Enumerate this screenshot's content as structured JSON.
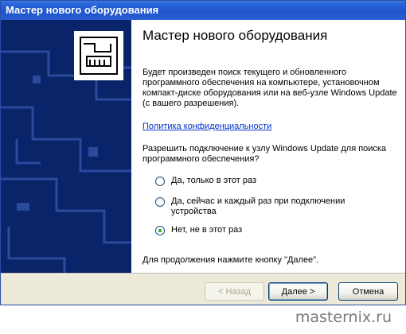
{
  "window": {
    "title": "Мастер нового оборудования"
  },
  "side": {
    "image_icon": "hardware-card-icon"
  },
  "content": {
    "heading": "Мастер нового оборудования",
    "paragraph": "Будет произведен поиск текущего и обновленного программного обеспечения на компьютере, установочном компакт-диске оборудования или на веб-узле Windows Update (с вашего разрешения).",
    "privacy_link": "Политика конфиденциальности",
    "question": "Разрешить подключение к узлу Windows Update для поиска программного обеспечения?",
    "options": [
      {
        "label": "Да, только в этот раз",
        "checked": false
      },
      {
        "label": "Да, сейчас и каждый раз при подключении устройства",
        "checked": false
      },
      {
        "label": "Нет, не в этот раз",
        "checked": true
      }
    ],
    "footer": "Для продолжения нажмите кнопку \"Далее\"."
  },
  "buttons": {
    "back": "< Назад",
    "next": "Далее >",
    "cancel": "Отмена"
  },
  "watermark": "masternix.ru",
  "colors": {
    "title_bar": "#2862d8",
    "side_panel": "#0a246a",
    "dialog_bg": "#ece9d8",
    "link": "#0033cc"
  }
}
